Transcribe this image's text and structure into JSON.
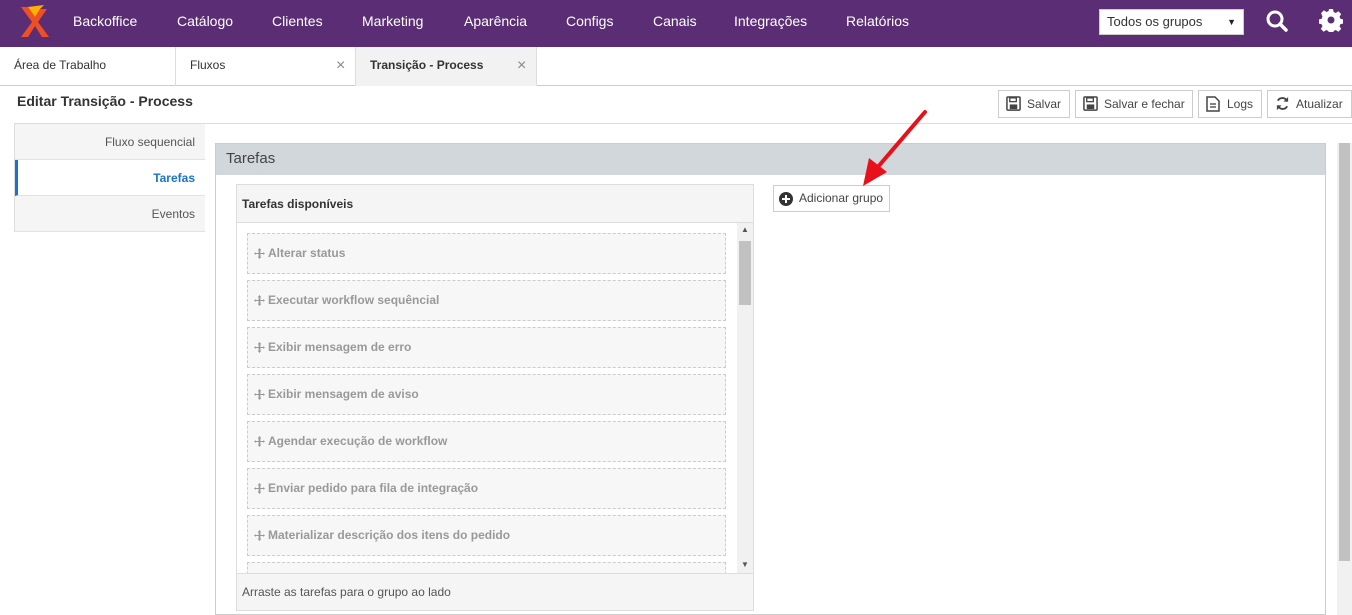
{
  "nav": {
    "items": [
      "Backoffice",
      "Catálogo",
      "Clientes",
      "Marketing",
      "Aparência",
      "Configs",
      "Canais",
      "Integrações",
      "Relatórios"
    ],
    "group_select": "Todos os grupos"
  },
  "tabs": [
    {
      "label": "Área de Trabalho"
    },
    {
      "label": "Fluxos"
    },
    {
      "label": "Transição - Process"
    }
  ],
  "page": {
    "title": "Editar Transição - Process",
    "buttons": {
      "save": "Salvar",
      "save_close": "Salvar e fechar",
      "logs": "Logs",
      "refresh": "Atualizar"
    }
  },
  "sidemenu": [
    "Fluxo sequencial",
    "Tarefas",
    "Eventos"
  ],
  "panel": {
    "title": "Tarefas",
    "available_title": "Tarefas disponíveis",
    "tasks": [
      "Alterar status",
      "Executar workflow sequêncial",
      "Exibir mensagem de erro",
      "Exibir mensagem de aviso",
      "Agendar execução de workflow",
      "Enviar pedido para fila de integração",
      "Materializar descrição dos itens do pedido"
    ],
    "footer": "Arraste as tarefas para o grupo ao lado",
    "add_group": "Adicionar grupo"
  },
  "colors": {
    "nav_bg": "#5a2d75",
    "accent": "#1a73c8",
    "logo": "#f04e23",
    "arrow": "#e8111b"
  }
}
